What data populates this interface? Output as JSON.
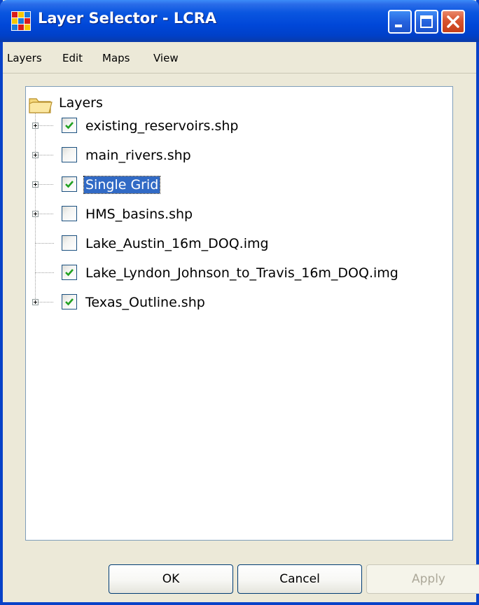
{
  "window": {
    "title": "Layer Selector - LCRA",
    "icon": "layer-grid-icon",
    "controls": [
      "minimize-icon",
      "maximize-icon",
      "close-icon"
    ]
  },
  "menu": {
    "items": [
      "Layers",
      "Edit",
      "Maps",
      "View"
    ]
  },
  "tree": {
    "root": "Layers",
    "items": [
      {
        "label": "existing_reservoirs.shp",
        "checked": true,
        "expandable": true,
        "selected": false
      },
      {
        "label": "main_rivers.shp",
        "checked": false,
        "expandable": true,
        "selected": false
      },
      {
        "label": "Single Grid",
        "checked": true,
        "expandable": true,
        "selected": true
      },
      {
        "label": "HMS_basins.shp",
        "checked": false,
        "expandable": true,
        "selected": false
      },
      {
        "label": "Lake_Austin_16m_DOQ.img",
        "checked": false,
        "expandable": false,
        "selected": false
      },
      {
        "label": "Lake_Lyndon_Johnson_to_Travis_16m_DOQ.img",
        "checked": true,
        "expandable": false,
        "selected": false
      },
      {
        "label": "Texas_Outline.shp",
        "checked": true,
        "expandable": true,
        "selected": false
      }
    ]
  },
  "buttons": {
    "ok": "OK",
    "cancel": "Cancel",
    "apply": "Apply",
    "apply_enabled": false
  },
  "colors": {
    "titlebar": "#0047d8",
    "selection": "#316ac5",
    "checkmark": "#21a121",
    "window_bg": "#ece9d8"
  }
}
